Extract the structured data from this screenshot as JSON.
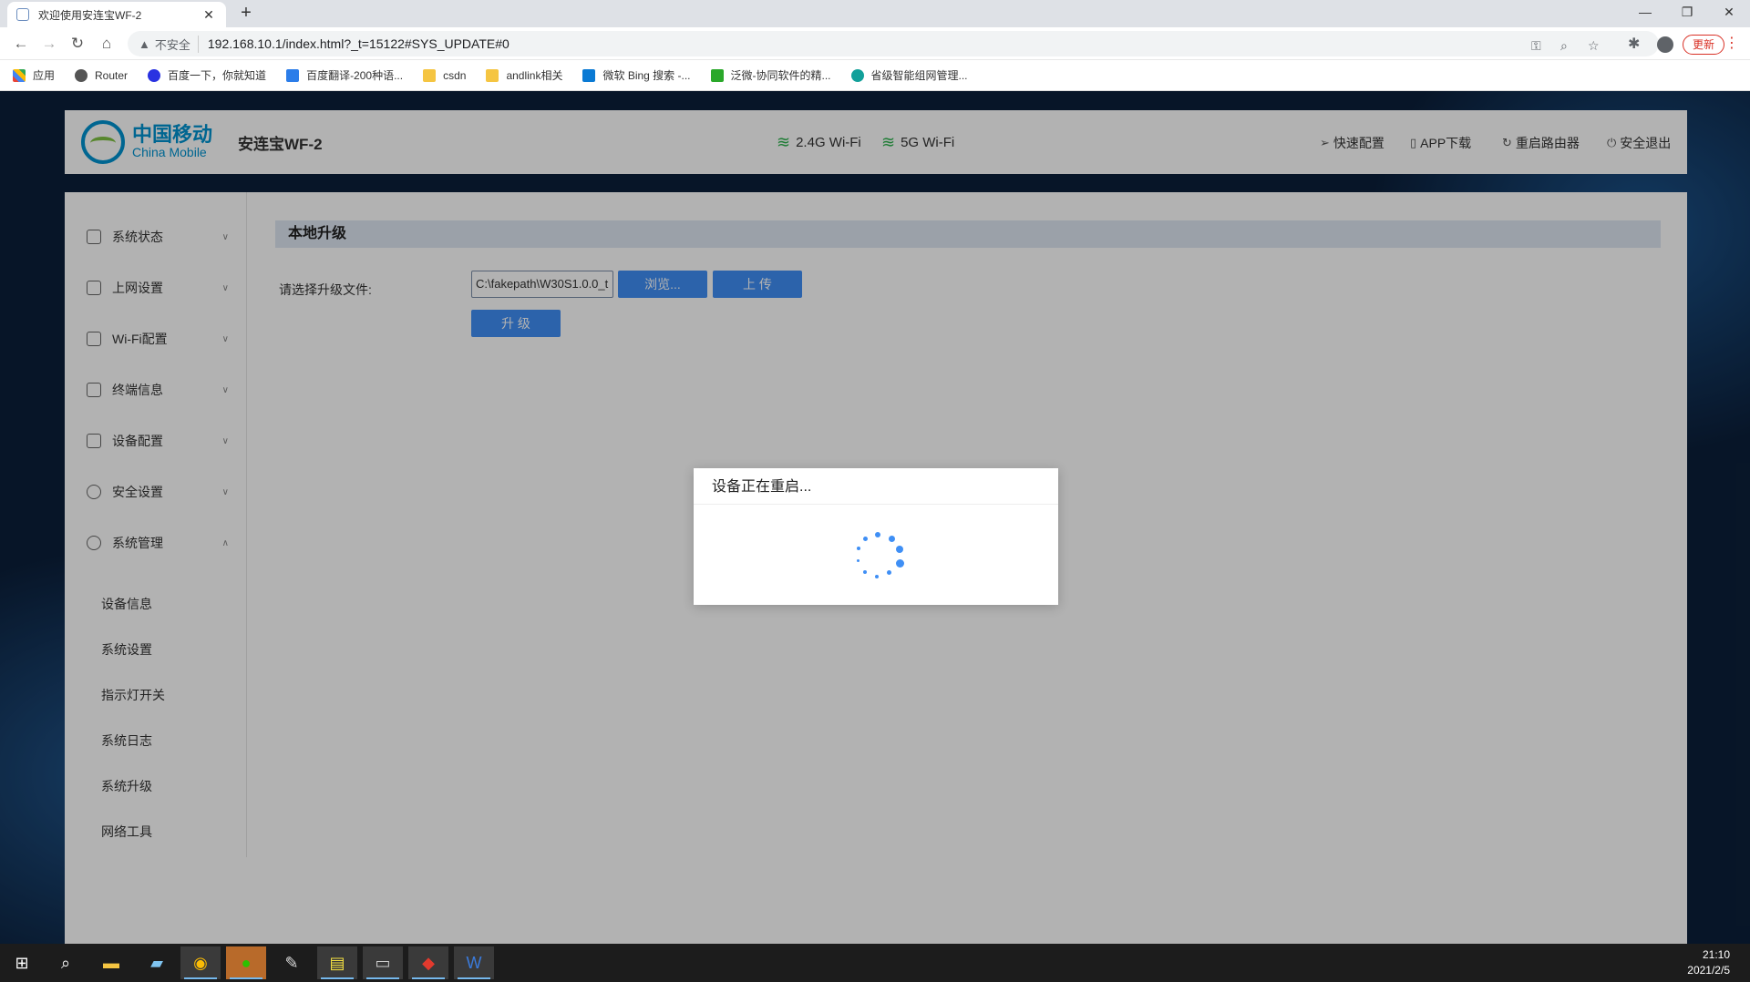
{
  "browser": {
    "tab_title": "欢迎使用安连宝WF-2",
    "security_label": "不安全",
    "url": "192.168.10.1/index.html?_t=15122#SYS_UPDATE#0",
    "update_label": "更新",
    "bookmarks": [
      {
        "label": "应用",
        "icon": "apps-grid-icon"
      },
      {
        "label": "Router",
        "icon": "globe-icon"
      },
      {
        "label": "百度一下，你就知道",
        "icon": "baidu-paw-icon"
      },
      {
        "label": "百度翻译-200种语...",
        "icon": "baidu-translate-icon"
      },
      {
        "label": "csdn",
        "icon": "folder-icon"
      },
      {
        "label": "andlink相关",
        "icon": "folder-icon"
      },
      {
        "label": "微软 Bing 搜索 -...",
        "icon": "bing-icon"
      },
      {
        "label": "泛微-协同软件的精...",
        "icon": "weaver-icon"
      },
      {
        "label": "省级智能组网管理...",
        "icon": "network-icon"
      }
    ]
  },
  "header": {
    "logo_cn": "中国移动",
    "logo_en": "China Mobile",
    "product": "安连宝WF-2",
    "wifi24": "2.4G Wi-Fi",
    "wifi5": "5G Wi-Fi",
    "links": {
      "quick": "快速配置",
      "app": "APP下载",
      "reboot": "重启路由器",
      "logout": "安全退出"
    }
  },
  "sidebar": {
    "items": [
      {
        "label": "系统状态"
      },
      {
        "label": "上网设置"
      },
      {
        "label": "Wi-Fi配置"
      },
      {
        "label": "终端信息"
      },
      {
        "label": "设备配置"
      },
      {
        "label": "安全设置"
      },
      {
        "label": "系统管理"
      }
    ],
    "subitems": [
      {
        "label": "设备信息"
      },
      {
        "label": "系统设置"
      },
      {
        "label": "指示灯开关"
      },
      {
        "label": "系统日志"
      },
      {
        "label": "系统升级"
      },
      {
        "label": "网络工具"
      }
    ]
  },
  "content": {
    "section_title": "本地升级",
    "file_label": "请选择升级文件:",
    "file_value": "C:\\fakepath\\W30S1.0.0_t",
    "browse_button": "浏览...",
    "upload_button": "上 传",
    "upgrade_button": "升 级"
  },
  "dialog": {
    "title": "设备正在重启..."
  },
  "taskbar": {
    "time": "21:10",
    "date": "2021/2/5"
  },
  "colors": {
    "accent": "#3f8ff5",
    "brand": "#0093d0",
    "wifi": "#2bb24c",
    "section_bg": "#dfe7f3"
  }
}
